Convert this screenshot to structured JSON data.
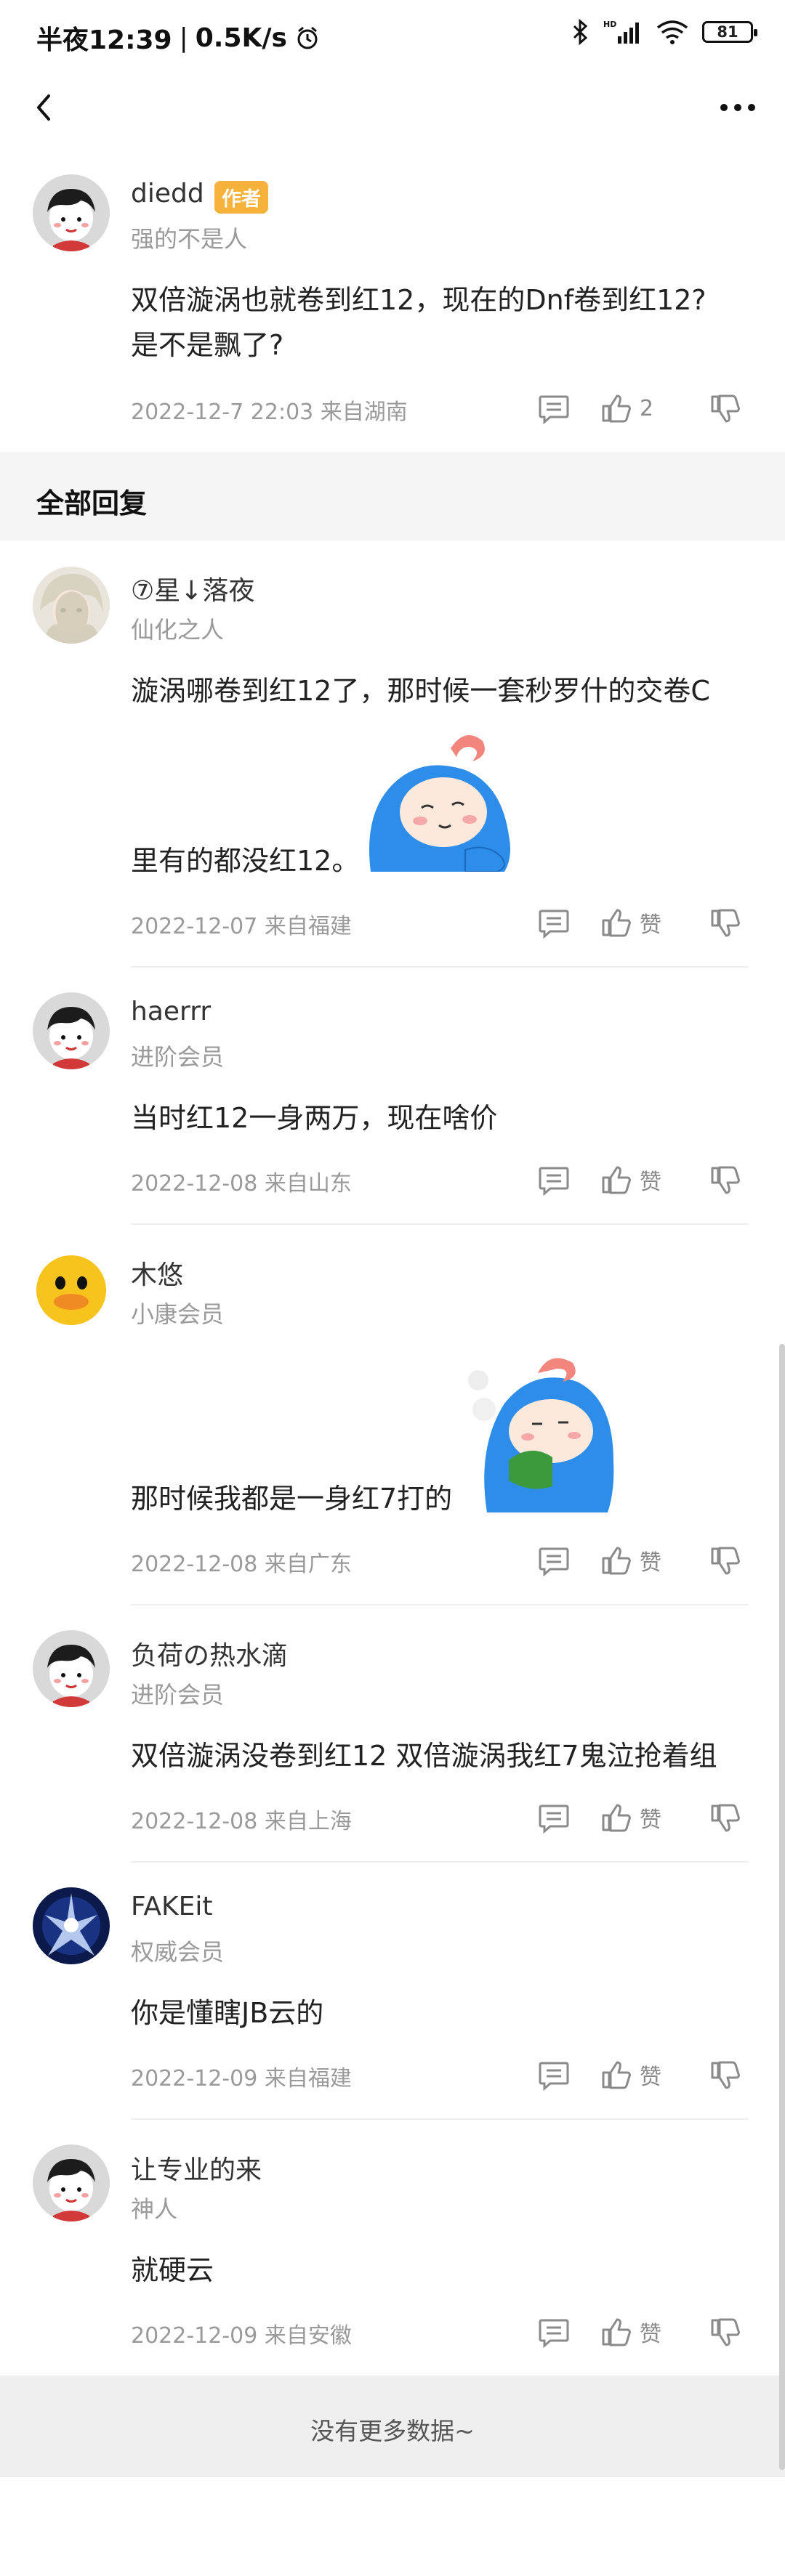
{
  "status_bar": {
    "time": "半夜12:39",
    "speed": "0.5K/s",
    "battery": "81"
  },
  "author_post": {
    "username": "diedd",
    "badge": "作者",
    "rank": "强的不是人",
    "text_line1": "双倍漩涡也就卷到红12，现在的Dnf卷到红12?",
    "text_line2": "是不是飘了?",
    "timestamp": "2022-12-7 22:03  来自湖南",
    "like_count": "2"
  },
  "section_title": "全部回复",
  "replies": [
    {
      "username": "⑦星↓落夜",
      "rank": "仙化之人",
      "text_line1": "漩涡哪卷到红12了，那时候一套秒罗什的交卷C",
      "text_line2": "里有的都没红12。",
      "timestamp": "2022-12-07 来自福建",
      "like_label": "赞"
    },
    {
      "username": "haerrr",
      "rank": "进阶会员",
      "text": "当时红12一身两万，现在啥价",
      "timestamp": "2022-12-08 来自山东",
      "like_label": "赞"
    },
    {
      "username": "木悠",
      "rank": "小康会员",
      "text": "那时候我都是一身红7打的",
      "timestamp": "2022-12-08 来自广东",
      "like_label": "赞"
    },
    {
      "username": "负荷の热水滴",
      "rank": "进阶会员",
      "text": "双倍漩涡没卷到红12 双倍漩涡我红7鬼泣抢着组",
      "timestamp": "2022-12-08 来自上海",
      "like_label": "赞"
    },
    {
      "username": "FAKEit",
      "rank": "权威会员",
      "text": "你是懂瞎JB云的",
      "timestamp": "2022-12-09 来自福建",
      "like_label": "赞"
    },
    {
      "username": "让专业的来",
      "rank": "神人",
      "text": "就硬云",
      "timestamp": "2022-12-09 来自安徽",
      "like_label": "赞"
    }
  ],
  "footer": {
    "no_more": "没有更多数据~"
  },
  "colors": {
    "badge": "#f7b23b",
    "meta_gray": "#9a9a9a",
    "band": "#f5f5f5"
  },
  "icons": [
    "back-arrow-icon",
    "more-dots-icon",
    "reply-icon",
    "thumbs-up-icon",
    "thumbs-down-icon"
  ]
}
